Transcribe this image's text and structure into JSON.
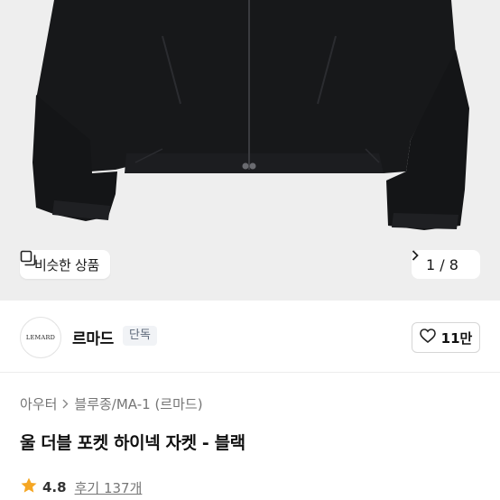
{
  "gallery": {
    "similar_label": "비슷한 상품",
    "page_indicator": "1 / 8",
    "image_alt": "black wool double pocket high-neck jacket"
  },
  "brand": {
    "logo_text": "LEMARD",
    "name": "르마드",
    "badge": "단독",
    "like_count": "11만"
  },
  "breadcrumb": {
    "items": [
      "아우터",
      "블루종/MA-1 (르마드)"
    ]
  },
  "product": {
    "title": "울 더블 포켓 하이넥 자켓 - 블랙"
  },
  "rating": {
    "score": "4.8",
    "reviews": "후기 137개"
  },
  "colors": {
    "star": "#f5a623",
    "hero_bg": "#eeeeee",
    "jacket": "#17181a"
  }
}
